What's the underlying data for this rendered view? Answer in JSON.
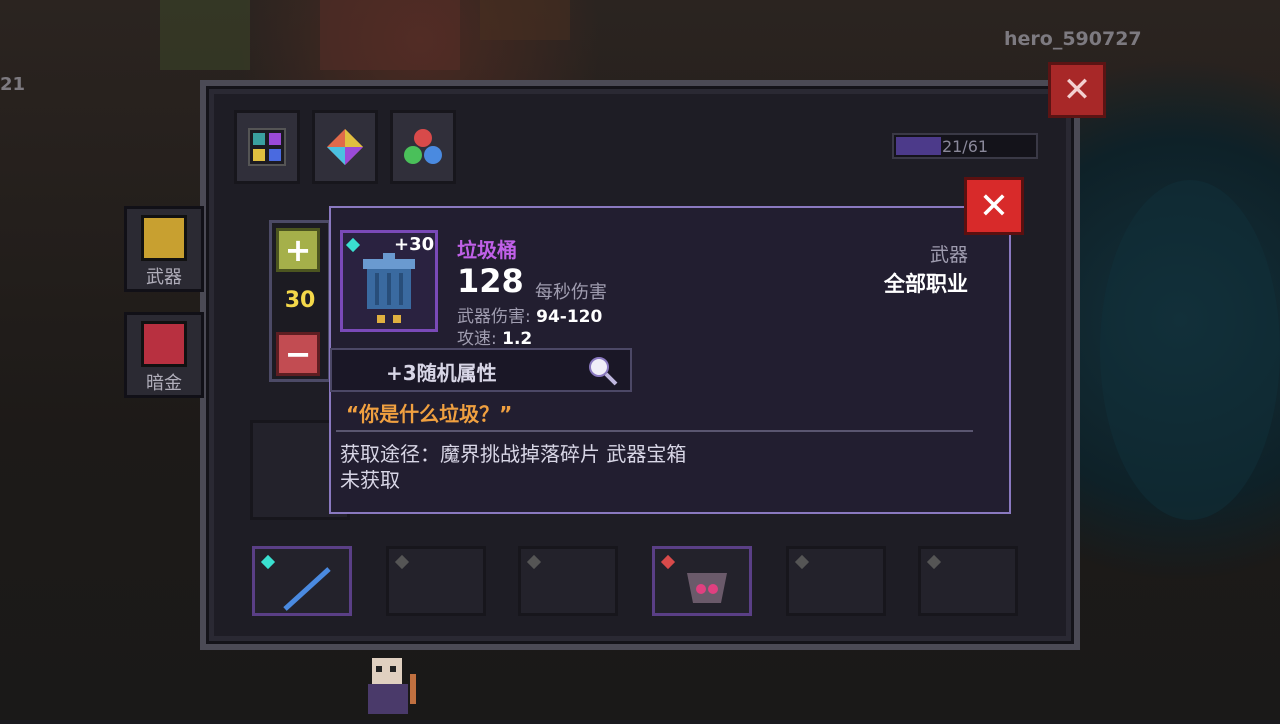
{
  "hud": {
    "username": "hero_590727",
    "left_counter": "21"
  },
  "window": {
    "close_label": "✕",
    "capacity": "21/61",
    "capacity_fraction": 0.33,
    "category_tabs": [
      {
        "icon": "grid-icon"
      },
      {
        "icon": "crystal-icon"
      },
      {
        "icon": "orbs-icon"
      }
    ],
    "sidebar": [
      {
        "label": "武器",
        "icon": "weapon-icon"
      },
      {
        "label": "暗金",
        "icon": "chest-icon"
      }
    ]
  },
  "stepper": {
    "plus_label": "+",
    "minus_label": "−",
    "quantity": "30"
  },
  "detail": {
    "close_label": "✕",
    "level": "+30",
    "name": "垃圾桶",
    "dps": "128",
    "dps_label": "每秒伤害",
    "damage_label": "武器伤害:",
    "damage_value": "94-120",
    "speed_label": "攻速:",
    "speed_value": "1.2",
    "category": "武器",
    "class": "全部职业",
    "random_attr": "+3随机属性",
    "quote": "“你是什么垃圾？”",
    "source": "获取途径：魔界挑战掉落碎片 武器宝箱",
    "status": "未获取",
    "colors": {
      "name": "#c060e8",
      "quote": "#f0a040"
    }
  }
}
